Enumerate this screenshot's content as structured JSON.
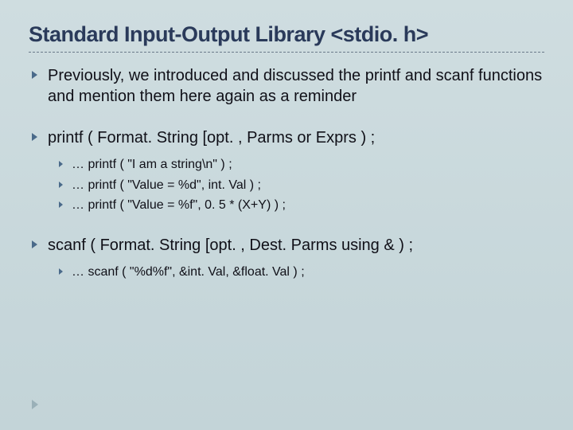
{
  "title": "Standard Input-Output Library <stdio. h>",
  "bullets": [
    {
      "text": "Previously, we introduced and discussed the printf and scanf functions and mention them here again as a reminder"
    },
    {
      "text": "printf ( Format. String [opt. , Parms or Exprs ) ;",
      "sub": [
        "…  printf ( \"I am a string\\n\" ) ;",
        "…  printf ( \"Value = %d\", int. Val ) ;",
        "…  printf ( \"Value = %f\", 0. 5 * (X+Y) ) ;"
      ]
    },
    {
      "text": "scanf ( Format. String [opt. , Dest. Parms using & ) ;",
      "sub": [
        "…  scanf ( \"%d%f\", &int. Val, &float. Val ) ;"
      ]
    }
  ]
}
